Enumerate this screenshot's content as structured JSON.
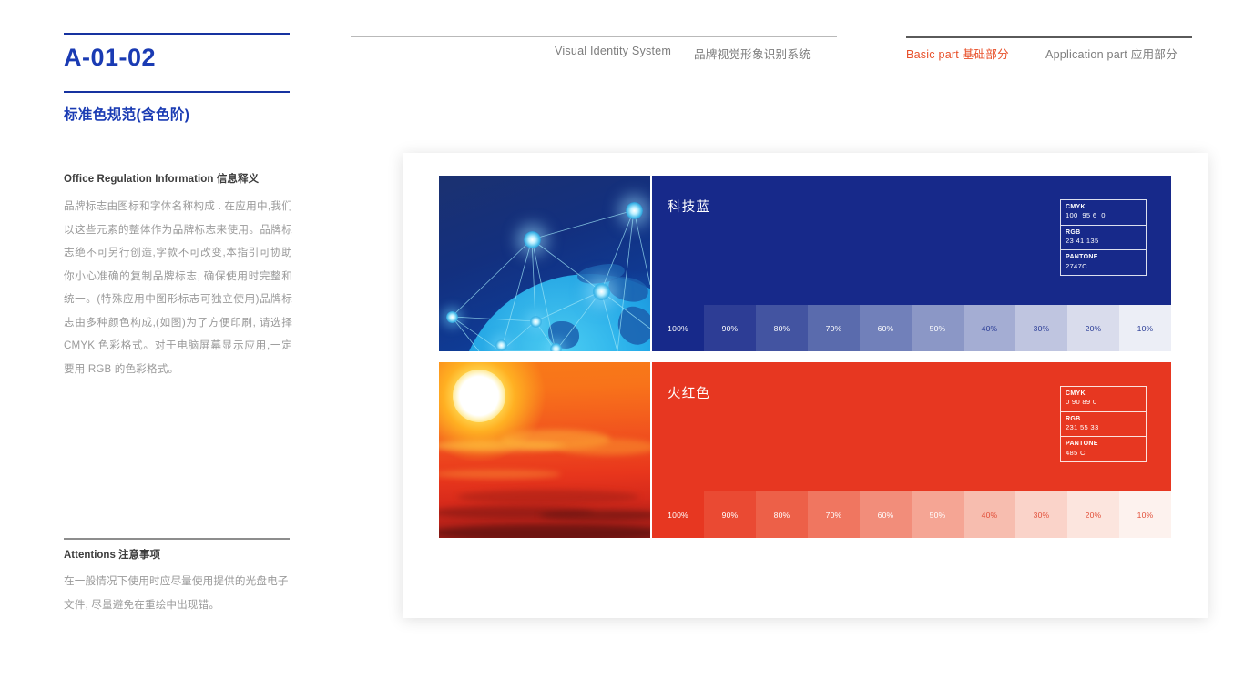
{
  "left": {
    "doc_code": "A-01-02",
    "section_title": "标准色规范(含色阶)",
    "info_heading": "Office Regulation Information  信息释义",
    "info_body": "品牌标志由图标和字体名称构成 . 在应用中,我们以这些元素的整体作为品牌标志来使用。品牌标志绝不可另行创造,字款不可改变,本指引可协助你小心准确的复制品牌标志, 确保使用时完整和统一。(特殊应用中图形标志可独立使用)品牌标志由多种颜色构成,(如图)为了方便印刷, 请选择 CMYK 色彩格式。对于电脑屏幕显示应用,一定要用 RGB 的色彩格式。",
    "attn_heading": "Attentions 注意事项",
    "attn_body": "在一般情况下使用时应尽量使用提供的光盘电子文件, 尽量避免在重绘中出现错。"
  },
  "nav": {
    "vis_en": "Visual Identity System",
    "vis_cn": "品牌视觉形象识别系统",
    "basic": "Basic part  基础部分",
    "application": "Application part  应用部分",
    "active_color": "#e8502a",
    "inactive_color": "#7d7d7d"
  },
  "swatches": [
    {
      "id": "tech-blue",
      "name": "科技蓝",
      "base_hex": "#17298A",
      "photo": "network-globe-photo",
      "spec": [
        {
          "label": "CMYK",
          "value": "100  95 6  0"
        },
        {
          "label": "RGB",
          "value": "23 41 135"
        },
        {
          "label": "PANTONE",
          "value": "2747C"
        }
      ],
      "tints": [
        {
          "label": "100%",
          "hex": "#17298A",
          "text": "#ffffff"
        },
        {
          "label": "90%",
          "hex": "#2d3d95",
          "text": "#ffffff"
        },
        {
          "label": "80%",
          "hex": "#4354a1",
          "text": "#ffffff"
        },
        {
          "label": "70%",
          "hex": "#5a6bad",
          "text": "#ffffff"
        },
        {
          "label": "60%",
          "hex": "#7180ba",
          "text": "#ffffff"
        },
        {
          "label": "50%",
          "hex": "#8b97c6",
          "text": "#ffffff"
        },
        {
          "label": "40%",
          "hex": "#a4add3",
          "text": "#2a3c96"
        },
        {
          "label": "30%",
          "hex": "#bfc5e0",
          "text": "#2a3c96"
        },
        {
          "label": "20%",
          "hex": "#d9dcec",
          "text": "#2a3c96"
        },
        {
          "label": "10%",
          "hex": "#eceef6",
          "text": "#2a3c96"
        }
      ]
    },
    {
      "id": "fire-red",
      "name": "火红色",
      "base_hex": "#E73721",
      "photo": "sunset-photo",
      "spec": [
        {
          "label": "CMYK",
          "value": "0 90 89 0"
        },
        {
          "label": "RGB",
          "value": "231 55 33"
        },
        {
          "label": "PANTONE",
          "value": "485 C"
        }
      ],
      "tints": [
        {
          "label": "100%",
          "hex": "#E73721",
          "text": "#ffffff"
        },
        {
          "label": "90%",
          "hex": "#ea4a33",
          "text": "#ffffff"
        },
        {
          "label": "80%",
          "hex": "#ed6048",
          "text": "#ffffff"
        },
        {
          "label": "70%",
          "hex": "#f07660",
          "text": "#ffffff"
        },
        {
          "label": "60%",
          "hex": "#f28d7a",
          "text": "#ffffff"
        },
        {
          "label": "50%",
          "hex": "#f5a594",
          "text": "#ffffff"
        },
        {
          "label": "40%",
          "hex": "#f7bdaf",
          "text": "#e2503a"
        },
        {
          "label": "30%",
          "hex": "#fad3c9",
          "text": "#e2503a"
        },
        {
          "label": "20%",
          "hex": "#fce5de",
          "text": "#e2503a"
        },
        {
          "label": "10%",
          "hex": "#fdf2ee",
          "text": "#e2503a"
        }
      ]
    }
  ]
}
